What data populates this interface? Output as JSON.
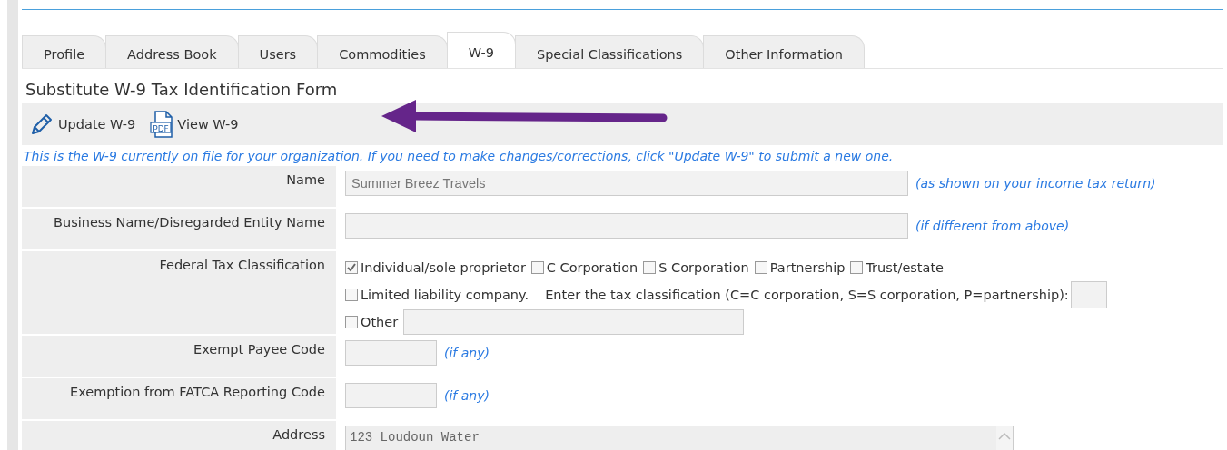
{
  "tabs": [
    {
      "label": "Profile",
      "selected": false
    },
    {
      "label": "Address Book",
      "selected": false
    },
    {
      "label": "Users",
      "selected": false
    },
    {
      "label": "Commodities",
      "selected": false
    },
    {
      "label": "W-9",
      "selected": true
    },
    {
      "label": "Special Classifications",
      "selected": false
    },
    {
      "label": "Other Information",
      "selected": false
    }
  ],
  "form_title": "Substitute W-9 Tax Identification Form",
  "toolbar": [
    {
      "kind": "edit",
      "label": "Update W-9"
    },
    {
      "kind": "pdf",
      "label": "View W-9",
      "icon_text": "PDF"
    }
  ],
  "notice": "This is the W-9 currently on file for your organization. If you need to make changes/corrections, click \"Update W-9\" to submit a new one.",
  "rows": [
    {
      "kind": "text",
      "label": "Name",
      "value": "Summer Breez Travels",
      "hint": "(as shown on your income tax return)"
    },
    {
      "kind": "text",
      "label": "Business Name/Disregarded Entity Name",
      "hint": "(if different from above)"
    },
    {
      "kind": "classification",
      "label": "Federal Tax Classification",
      "options": [
        {
          "label": "Individual/sole proprietor",
          "checked": true
        },
        {
          "label": "C Corporation",
          "checked": false
        },
        {
          "label": "S Corporation",
          "checked": false
        },
        {
          "label": "Partnership",
          "checked": false
        },
        {
          "label": "Trust/estate",
          "checked": false
        }
      ],
      "llc": {
        "label": "Limited liability company.",
        "checked": false,
        "prompt": "Enter the tax classification (C=C corporation, S=S corporation, P=partnership):"
      },
      "other": {
        "label": "Other",
        "checked": false
      }
    },
    {
      "kind": "code",
      "label": "Exempt Payee Code",
      "hint": "(if any)"
    },
    {
      "kind": "code",
      "label": "Exemption from FATCA Reporting Code",
      "hint": "(if any)"
    },
    {
      "kind": "textarea",
      "label": "Address",
      "value": "123 Loudoun Water"
    }
  ]
}
